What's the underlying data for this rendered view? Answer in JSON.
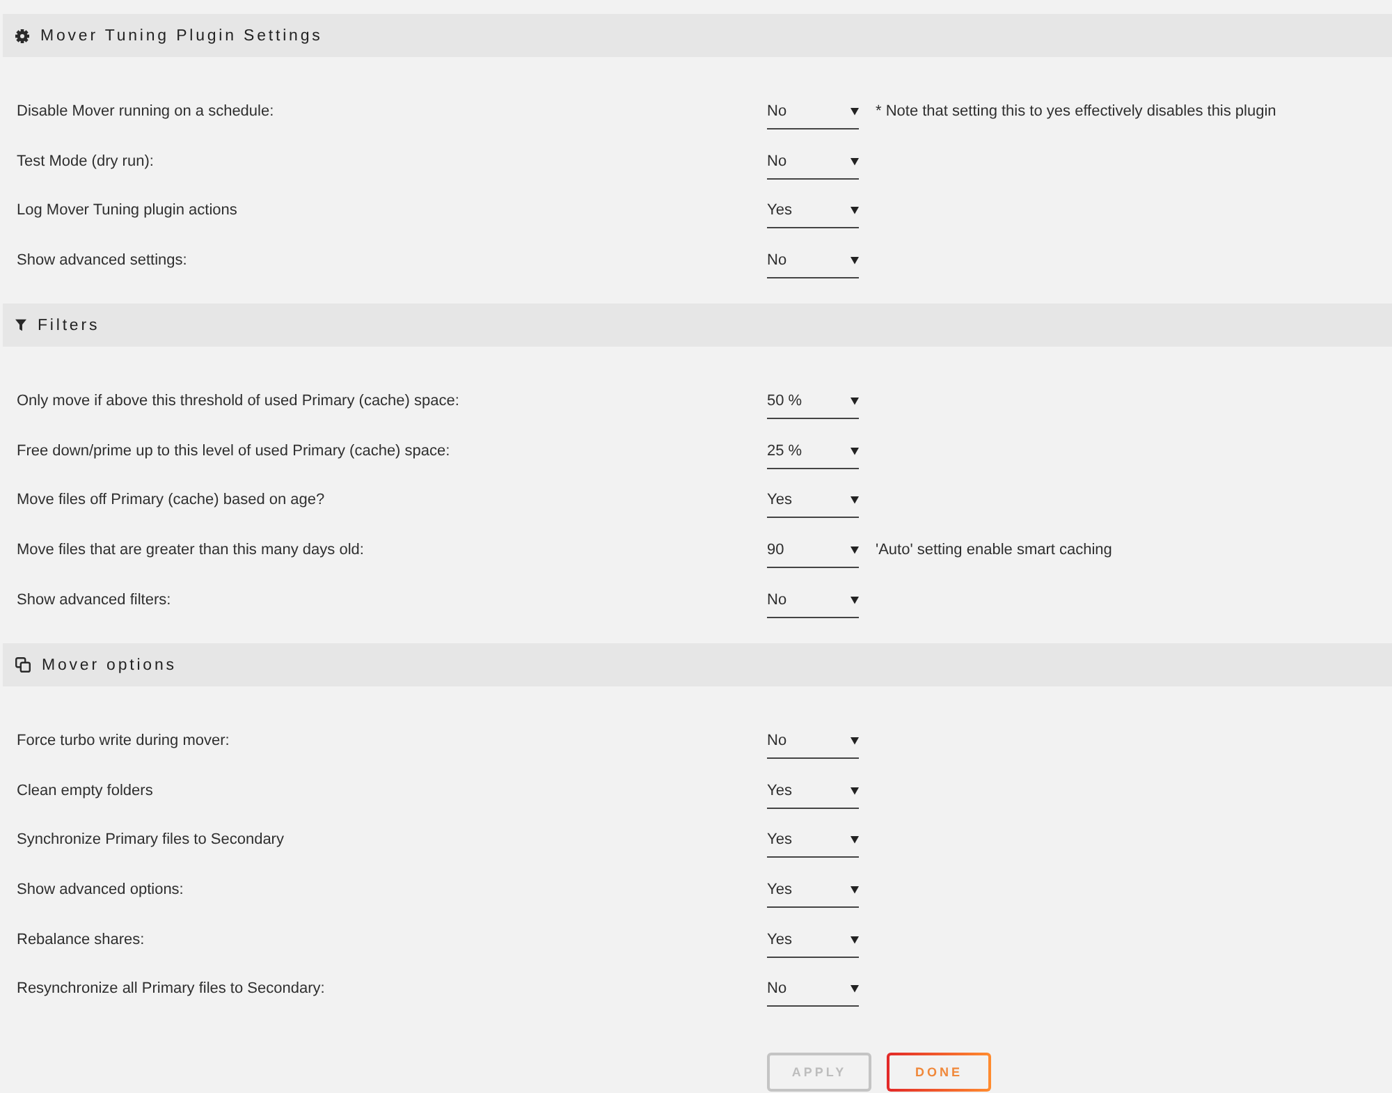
{
  "sections": [
    {
      "title": "Mover Tuning Plugin Settings",
      "settings": [
        {
          "label": "Disable Mover running on a schedule:",
          "value": "No",
          "note": "* Note that setting this to yes effectively disables this plugin"
        },
        {
          "label": "Test Mode (dry run):",
          "value": "No"
        },
        {
          "label": "Log Mover Tuning plugin actions",
          "value": "Yes"
        },
        {
          "label": "Show advanced settings:",
          "value": "No"
        }
      ]
    },
    {
      "title": "Filters",
      "settings": [
        {
          "label": "Only move if above this threshold of used Primary (cache) space:",
          "value": "50 %"
        },
        {
          "label": "Free down/prime up to this level of used Primary (cache) space:",
          "value": "25 %"
        },
        {
          "label": "Move files off Primary (cache) based on age?",
          "value": "Yes"
        },
        {
          "label": "Move files that are greater than this many days old:",
          "value": "90",
          "note": "'Auto' setting enable smart caching"
        },
        {
          "label": "Show advanced filters:",
          "value": "No"
        }
      ]
    },
    {
      "title": "Mover options",
      "settings": [
        {
          "label": "Force turbo write during mover:",
          "value": "No"
        },
        {
          "label": "Clean empty folders",
          "value": "Yes"
        },
        {
          "label": "Synchronize Primary files to Secondary",
          "value": "Yes"
        },
        {
          "label": "Show advanced options:",
          "value": "Yes"
        },
        {
          "label": "Rebalance shares:",
          "value": "Yes"
        },
        {
          "label": "Resynchronize all Primary files to Secondary:",
          "value": "No"
        }
      ]
    }
  ],
  "buttons": [
    {
      "label": "APPLY",
      "disabled": true
    },
    {
      "label": "DONE",
      "disabled": false
    }
  ]
}
